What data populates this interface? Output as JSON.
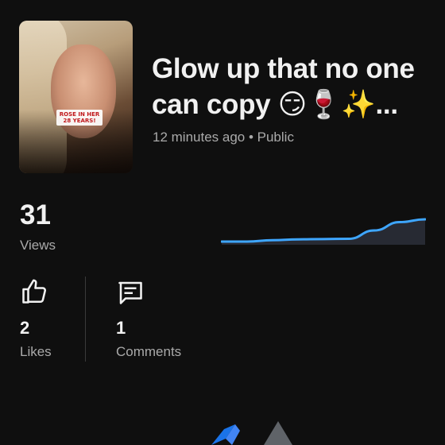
{
  "video": {
    "title": "Glow up that no one can copy 😏🍷✨...",
    "meta": "12 minutes ago • Public",
    "thumbnail_caption": "ROSE IN HER 28 YEARS!"
  },
  "stats": {
    "views": "31",
    "views_label": "Views",
    "likes": "2",
    "likes_label": "Likes",
    "comments": "1",
    "comments_label": "Comments"
  },
  "chart_data": {
    "type": "area",
    "values": [
      0,
      0,
      0.5,
      0.8,
      0.9,
      1,
      4,
      7,
      8
    ]
  },
  "colors": {
    "background": "#0f0f0f",
    "accent_line": "#3ea6ff",
    "muted_text": "#aaaaaa"
  },
  "icons": {
    "likes": "thumbs-up-icon",
    "comments": "comment-icon"
  }
}
